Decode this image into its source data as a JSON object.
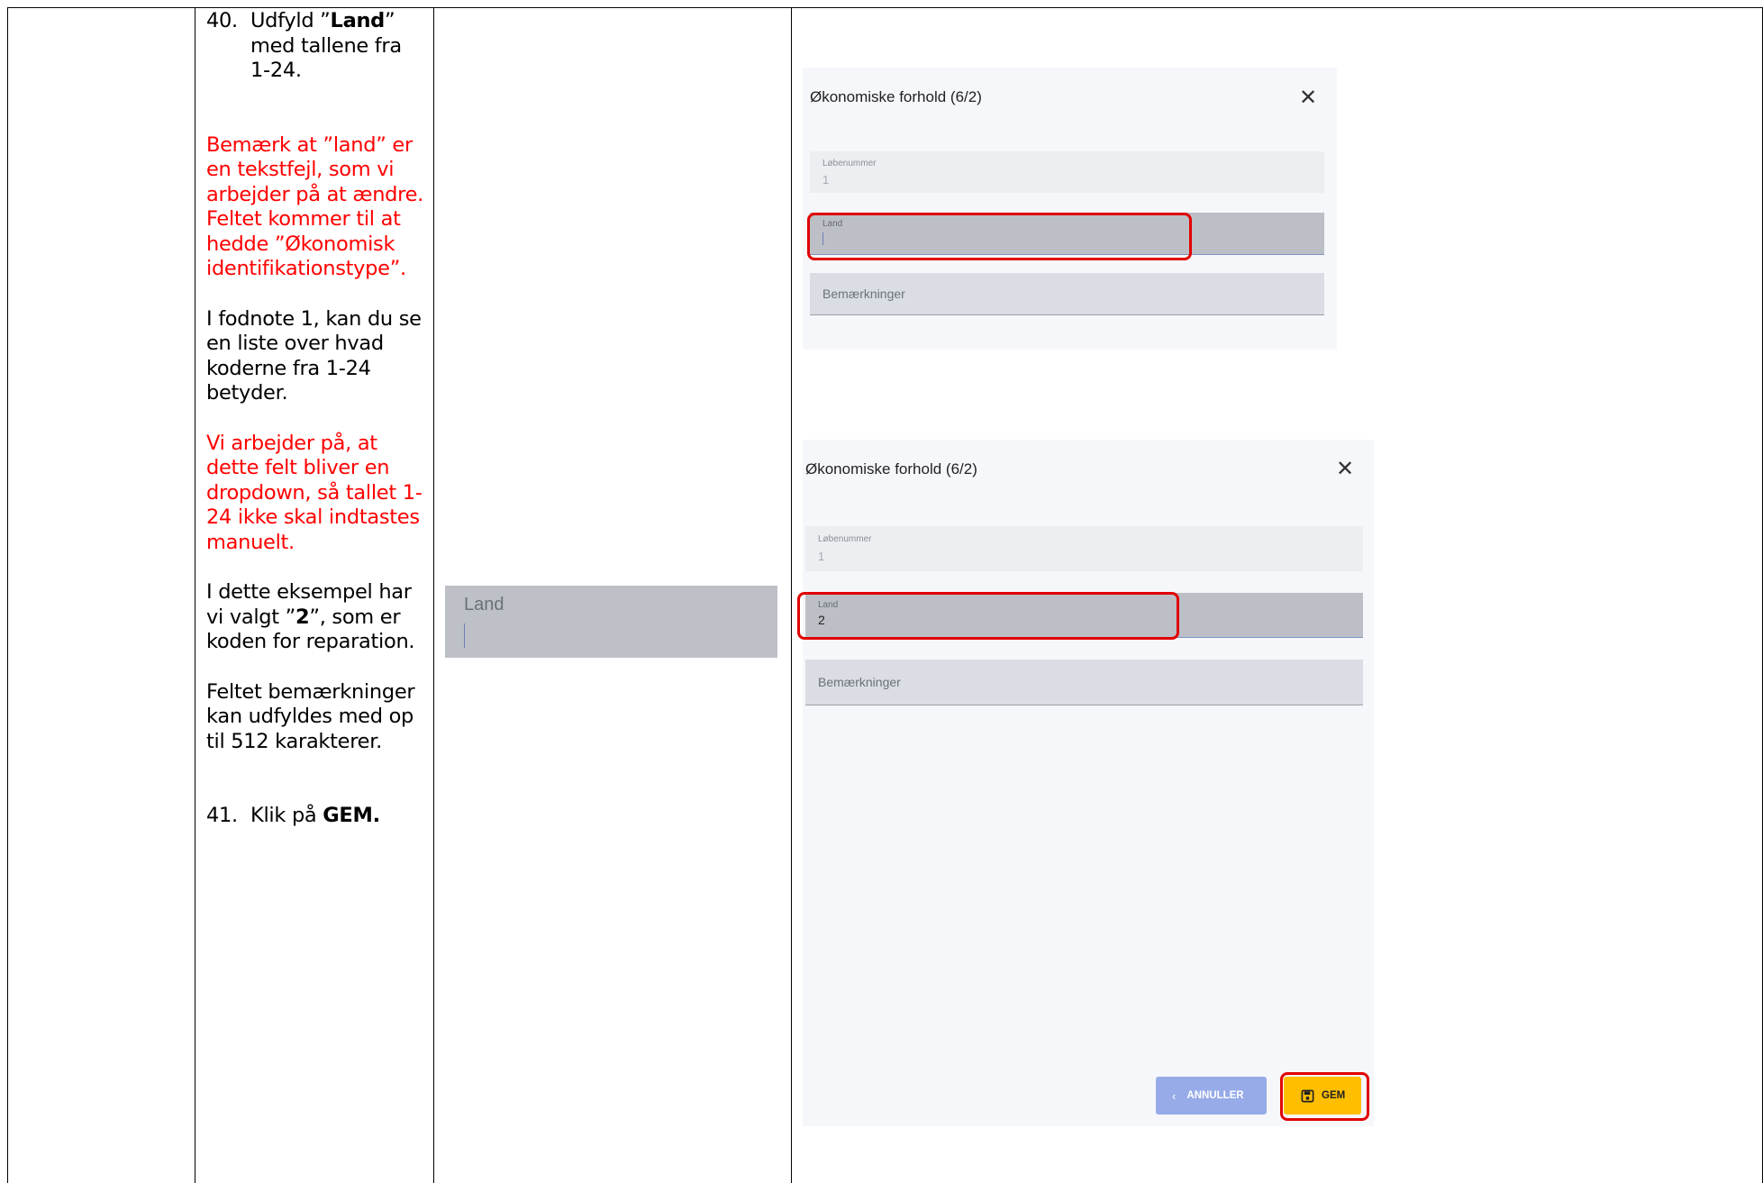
{
  "instructions": {
    "step40": {
      "number": "40.",
      "text_1": "Udfyld ”",
      "bold_1": "Land",
      "text_2": "” med tallene fra 1-24."
    },
    "note_red_1": "Bemærk at ”land” er en tekstfejl, som vi arbejder på at ændre. Feltet kommer til at hedde ”Økonomisk identifikationstype”.",
    "note_footnote": "I fodnote 1, kan du se en liste over hvad koderne fra 1-24 betyder.",
    "note_red_2": "Vi arbejder på, at dette felt bliver en dropdown, så tallet 1-24 ikke skal indtastes manuelt.",
    "example": {
      "text_1": "I dette eksempel har vi valgt ”",
      "bold": "2",
      "text_2": "”, som er koden for reparation."
    },
    "note_remarks": "Feltet bemærkninger kan udfyldes med op til 512 karakterer.",
    "step41": {
      "number": "41.",
      "text": "Klik på ",
      "bold": "GEM."
    }
  },
  "zoom": {
    "label": "Land"
  },
  "dialog_top": {
    "title": "Økonomiske forhold (6/2)",
    "close_glyph": "✕",
    "fields": {
      "lobenummer_label": "Løbenummer",
      "lobenummer_value": "1",
      "land_label": "Land",
      "land_value": "",
      "bemaerkninger_placeholder": "Bemærkninger"
    }
  },
  "dialog_bottom": {
    "title": "Økonomiske forhold (6/2)",
    "close_glyph": "✕",
    "fields": {
      "lobenummer_label": "Løbenummer",
      "lobenummer_value": "1",
      "land_label": "Land",
      "land_value": "2",
      "bemaerkninger_placeholder": "Bemærkninger"
    },
    "buttons": {
      "cancel_label": "ANNULLER",
      "cancel_icon": "chevron-left-icon",
      "save_label": "GEM",
      "save_icon": "floppy-disk-icon"
    }
  },
  "colors": {
    "note_red": "#ff0000",
    "highlight_red": "#e00000",
    "save_button": "#ffbf00",
    "cancel_button": "#96abe8"
  }
}
